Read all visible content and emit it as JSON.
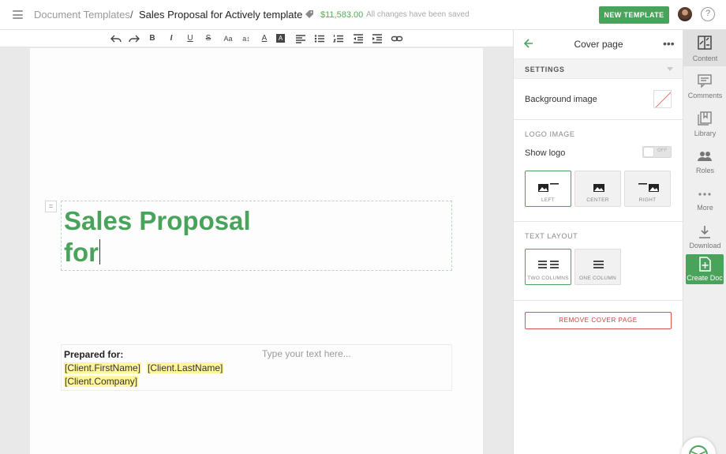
{
  "header": {
    "breadcrumb_root": "Document Templates",
    "breadcrumb_sep": "/",
    "document_title": "Sales Proposal for Actively template",
    "price": "$11,583.00",
    "save_status": "All changes have been saved",
    "new_template_label": "NEW TEMPLATE",
    "help_label": "?"
  },
  "toolbar": {
    "tools": [
      "undo-icon",
      "redo-icon",
      "bold-icon",
      "italic-icon",
      "underline-icon",
      "strikethrough-icon",
      "font-size-icon",
      "line-height-icon",
      "text-color-icon",
      "highlight-icon",
      "align-left-icon",
      "bullet-list-icon",
      "numbered-list-icon",
      "outdent-icon",
      "indent-icon",
      "link-icon"
    ],
    "bold": "B",
    "italic": "I",
    "underline": "U",
    "strike": "S",
    "font_size": "Aa",
    "line_height": "a",
    "text_color": "A",
    "highlight": "A"
  },
  "document": {
    "title_line1": "Sales Proposal",
    "title_line2": "for",
    "drag_handle": "=",
    "prepared_label": "Prepared for:",
    "client_first": "[Client.FirstName]",
    "client_last": "[Client.LastName]",
    "client_company": "[Client.Company]",
    "placeholder": "Type your text here..."
  },
  "panel": {
    "title": "Cover page",
    "more": "•••",
    "settings_label": "SETTINGS",
    "background_image_label": "Background image",
    "logo_section_label": "LOGO IMAGE",
    "show_logo_label": "Show logo",
    "show_logo_state": "OFF",
    "logo_positions": [
      {
        "label": "LEFT",
        "selected": true
      },
      {
        "label": "CENTER",
        "selected": false
      },
      {
        "label": "RIGHT",
        "selected": false
      }
    ],
    "text_layout_label": "TEXT LAYOUT",
    "text_layouts": [
      {
        "label": "TWO COLUMNS",
        "selected": true
      },
      {
        "label": "ONE COLUMN",
        "selected": false
      }
    ],
    "remove_cover_label": "REMOVE COVER PAGE"
  },
  "rail": {
    "content": "Content",
    "comments": "Comments",
    "library": "Library",
    "roles": "Roles",
    "more": "More",
    "download": "Download",
    "create_doc": "Create Doc"
  },
  "colors": {
    "accent": "#4aa35b",
    "danger": "#d9534f",
    "token_highlight": "#fff59a"
  }
}
